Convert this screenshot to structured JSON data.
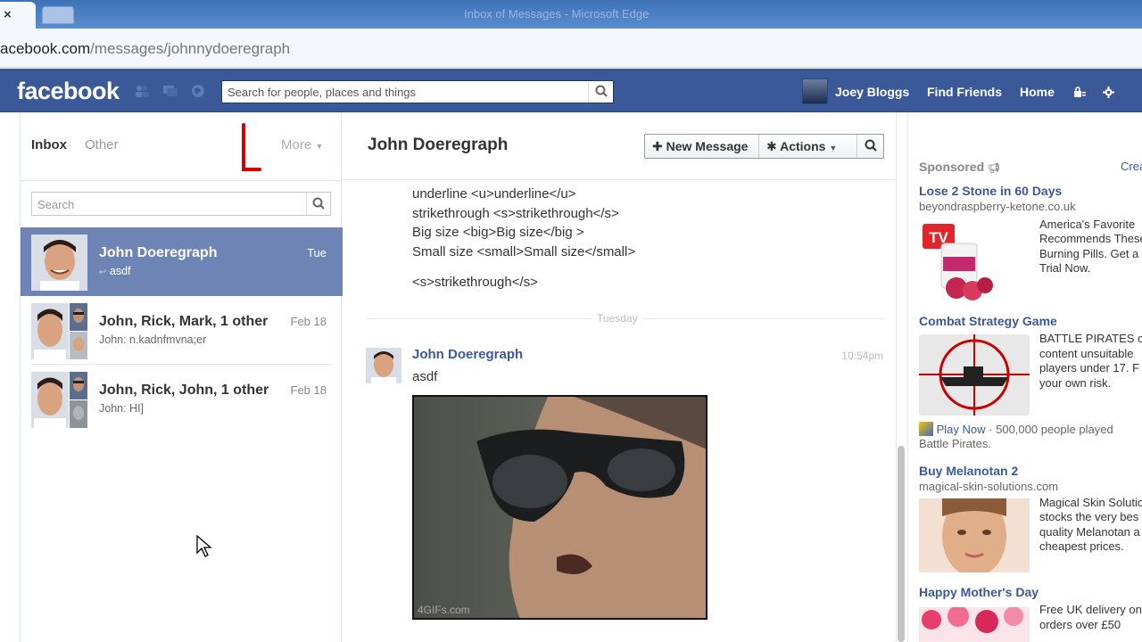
{
  "browser": {
    "window_title": "Inbox of Messages - Microsoft Edge",
    "url_host": "acebook.com",
    "url_path": "/messages/johnnydoeregraph",
    "tab_close": "×"
  },
  "topbar": {
    "logo": "facebook",
    "search_placeholder": "Search for people, places and things",
    "user_name": "Joey Bloggs",
    "find_friends": "Find Friends",
    "home": "Home"
  },
  "sidebar": {
    "tab_inbox": "Inbox",
    "tab_other": "Other",
    "tab_more": "More",
    "search_placeholder": "Search",
    "threads": [
      {
        "name": "John Doeregraph",
        "date": "Tue",
        "snippet": "asdf"
      },
      {
        "name": "John, Rick, Mark, 1 other",
        "date": "Feb 18",
        "snippet": "John: n.kadnfmvna;er"
      },
      {
        "name": "John, Rick, John, 1 other",
        "date": "Feb 18",
        "snippet": "John: HI]"
      }
    ]
  },
  "conversation": {
    "title": "John Doeregraph",
    "new_message": "New Message",
    "actions": "Actions",
    "lines": [
      "underline <u>underline</u>",
      "strikethrough <s>strikethrough</s>",
      "Big size <big>Big size</big >",
      "Small size <small>Small size</small>",
      "<s>strikethrough</s>"
    ],
    "day_label": "Tuesday",
    "message": {
      "sender": "John Doeregraph",
      "time": "10:54pm",
      "text": "asdf",
      "gif_watermark": "4GIFs.com"
    }
  },
  "ads": {
    "sponsored": "Sponsored",
    "create": "Crea",
    "items": [
      {
        "title": "Lose 2 Stone in 60 Days",
        "domain": "beyondraspberry-ketone.co.uk",
        "body": [
          "America's Favorite",
          "Recommends These",
          "Burning Pills. Get a",
          "Trial Now."
        ],
        "img_text": "TV"
      },
      {
        "title": "Combat Strategy Game",
        "domain": "",
        "body": [
          "BATTLE PIRATES co",
          "content unsuitable",
          "players under 17. F",
          "your own risk."
        ],
        "extra_link": "Play Now",
        "extra_text": "· 500,000 people played",
        "extra_line2": "Battle Pirates."
      },
      {
        "title": "Buy Melanotan 2",
        "domain": "magical-skin-solutions.com",
        "body": [
          "Magical Skin Solutio",
          "stocks the very bes",
          "quality Melanotan a",
          "cheapest prices."
        ]
      },
      {
        "title": "Happy Mother's Day",
        "domain": "",
        "body": [
          "Free UK delivery on",
          "orders over £50"
        ]
      }
    ]
  }
}
